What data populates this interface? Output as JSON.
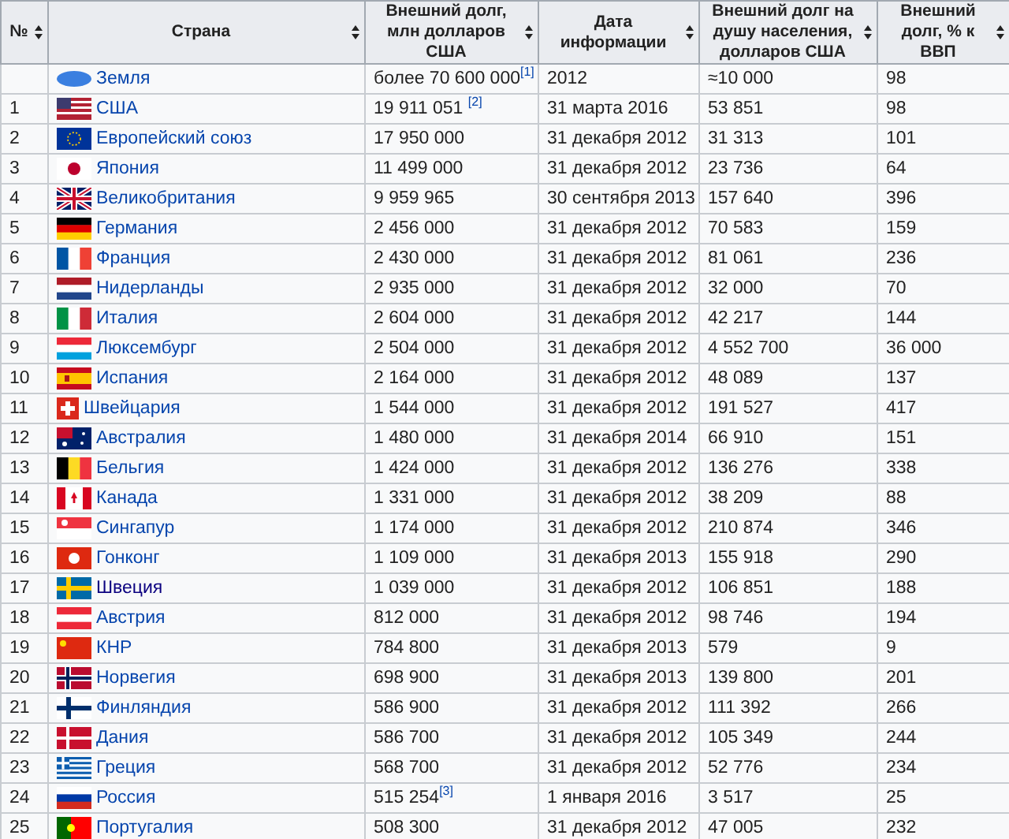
{
  "table": {
    "columns": [
      {
        "label": "№"
      },
      {
        "label": "Страна"
      },
      {
        "label": "Внешний долг, млн долларов США"
      },
      {
        "label": "Дата информации"
      },
      {
        "label": "Внешний долг на душу населения, долларов США"
      },
      {
        "label": "Внешний долг, % к ВВП"
      }
    ],
    "rows": [
      {
        "rank": "",
        "country": "Земля",
        "visited": false,
        "debt": "более 70 600 000$^{[1]}$",
        "date": "2012",
        "per_capita": "≈10 000",
        "gdp_share": "98"
      },
      {
        "rank": "1",
        "country": "США",
        "visited": false,
        "debt": "19 911 051 $^{[2]}$",
        "date": "31 марта 2016",
        "per_capita": "53 851",
        "gdp_share": "98"
      },
      {
        "rank": "2",
        "country": "Европейский союз",
        "visited": false,
        "debt": "17 950 000",
        "date": "31 декабря 2012",
        "per_capita": "31 313",
        "gdp_share": "101"
      },
      {
        "rank": "3",
        "country": "Япония",
        "visited": false,
        "debt": "11 499 000",
        "date": "31 декабря 2012",
        "per_capita": "23 736",
        "gdp_share": "64"
      },
      {
        "rank": "4",
        "country": "Великобритания",
        "visited": false,
        "debt": "9 959 965",
        "date": "30 сентября 2013",
        "per_capita": "157 640",
        "gdp_share": "396"
      },
      {
        "rank": "5",
        "country": "Германия",
        "visited": false,
        "debt": "2 456 000",
        "date": "31 декабря 2012",
        "per_capita": "70 583",
        "gdp_share": "159"
      },
      {
        "rank": "6",
        "country": "Франция",
        "visited": false,
        "debt": "2 430 000",
        "date": "31 декабря 2012",
        "per_capita": "81 061",
        "gdp_share": "236"
      },
      {
        "rank": "7",
        "country": "Нидерланды",
        "visited": false,
        "debt": "2 935 000",
        "date": "31 декабря 2012",
        "per_capita": "32 000",
        "gdp_share": "70"
      },
      {
        "rank": "8",
        "country": "Италия",
        "visited": false,
        "debt": "2 604 000",
        "date": "31 декабря 2012",
        "per_capita": "42 217",
        "gdp_share": "144"
      },
      {
        "rank": "9",
        "country": "Люксембург",
        "visited": false,
        "debt": "2 504 000",
        "date": "31 декабря 2012",
        "per_capita": "4 552 700",
        "gdp_share": "36 000"
      },
      {
        "rank": "10",
        "country": "Испания",
        "visited": false,
        "debt": "2 164 000",
        "date": "31 декабря 2012",
        "per_capita": "48 089",
        "gdp_share": "137"
      },
      {
        "rank": "11",
        "country": "Швейцария",
        "visited": false,
        "debt": "1 544 000",
        "date": "31 декабря 2012",
        "per_capita": "191 527",
        "gdp_share": "417"
      },
      {
        "rank": "12",
        "country": "Австралия",
        "visited": false,
        "debt": "1 480 000",
        "date": "31 декабря 2014",
        "per_capita": "66 910",
        "gdp_share": "151"
      },
      {
        "rank": "13",
        "country": "Бельгия",
        "visited": false,
        "debt": "1 424 000",
        "date": "31 декабря 2012",
        "per_capita": "136 276",
        "gdp_share": "338"
      },
      {
        "rank": "14",
        "country": "Канада",
        "visited": false,
        "debt": "1 331 000",
        "date": "31 декабря 2012",
        "per_capita": "38 209",
        "gdp_share": "88"
      },
      {
        "rank": "15",
        "country": "Сингапур",
        "visited": false,
        "debt": "1 174 000",
        "date": "31 декабря 2012",
        "per_capita": "210 874",
        "gdp_share": "346"
      },
      {
        "rank": "16",
        "country": "Гонконг",
        "visited": false,
        "debt": "1 109 000",
        "date": "31 декабря 2013",
        "per_capita": "155 918",
        "gdp_share": "290"
      },
      {
        "rank": "17",
        "country": "Швеция",
        "visited": true,
        "debt": "1 039 000",
        "date": "31 декабря 2012",
        "per_capita": "106 851",
        "gdp_share": "188"
      },
      {
        "rank": "18",
        "country": "Австрия",
        "visited": false,
        "debt": "812 000",
        "date": "31 декабря 2012",
        "per_capita": "98 746",
        "gdp_share": "194"
      },
      {
        "rank": "19",
        "country": "КНР",
        "visited": false,
        "debt": "784 800",
        "date": "31 декабря 2013",
        "per_capita": "579",
        "gdp_share": "9"
      },
      {
        "rank": "20",
        "country": "Норвегия",
        "visited": false,
        "debt": "698 900",
        "date": "31 декабря 2013",
        "per_capita": "139 800",
        "gdp_share": "201"
      },
      {
        "rank": "21",
        "country": "Финляндия",
        "visited": false,
        "debt": "586 900",
        "date": "31 декабря 2012",
        "per_capita": "111 392",
        "gdp_share": "266"
      },
      {
        "rank": "22",
        "country": "Дания",
        "visited": false,
        "debt": "586 700",
        "date": "31 декабря 2012",
        "per_capita": "105 349",
        "gdp_share": "244"
      },
      {
        "rank": "23",
        "country": "Греция",
        "visited": false,
        "debt": "568 700",
        "date": "31 декабря 2012",
        "per_capita": "52 776",
        "gdp_share": "234"
      },
      {
        "rank": "24",
        "country": "Россия",
        "visited": false,
        "debt": "515 254$^{[3]}$",
        "date": "1 января 2016",
        "per_capita": "3 517",
        "gdp_share": "25"
      },
      {
        "rank": "25",
        "country": "Португалия",
        "visited": false,
        "debt": "508 300",
        "date": "31 декабря 2012",
        "per_capita": "47 005",
        "gdp_share": "232"
      }
    ]
  }
}
